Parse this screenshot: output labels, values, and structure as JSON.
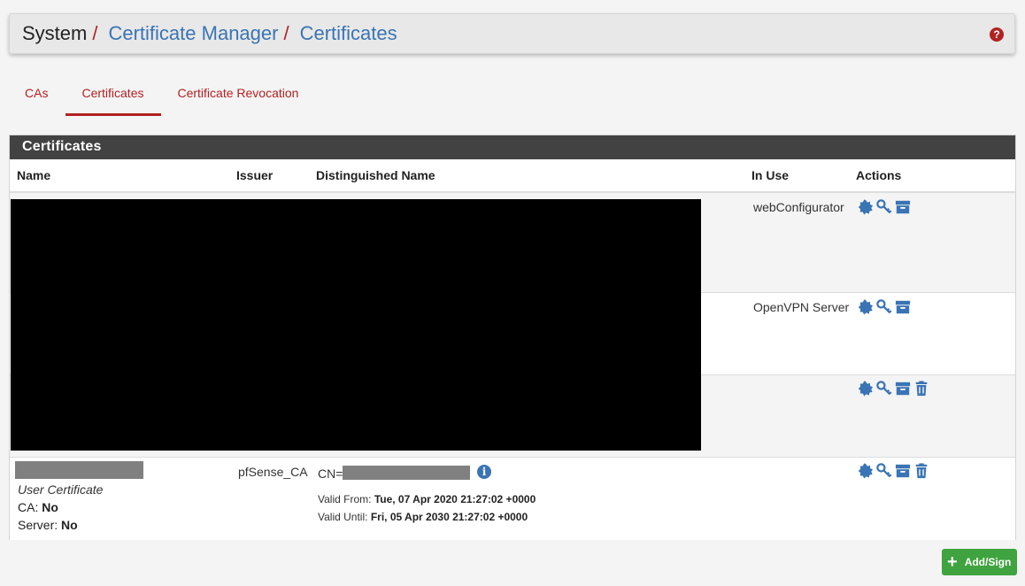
{
  "breadcrumb": {
    "root": "System",
    "sep": "/",
    "level1": "Certificate Manager",
    "level2": "Certificates",
    "help_glyph": "?"
  },
  "tabs": [
    {
      "label": "CAs",
      "active": false
    },
    {
      "label": "Certificates",
      "active": true
    },
    {
      "label": "Certificate Revocation",
      "active": false
    }
  ],
  "panel": {
    "title": "Certificates",
    "columns": [
      "Name",
      "Issuer",
      "Distinguished Name",
      "In Use",
      "Actions"
    ]
  },
  "rows": [
    {
      "in_use": "webConfigurator",
      "actions": [
        "export-certificate-icon",
        "export-key-icon",
        "export-p12-icon"
      ]
    },
    {
      "in_use": "OpenVPN Server",
      "actions": [
        "export-certificate-icon",
        "export-key-icon",
        "export-p12-icon"
      ]
    },
    {
      "in_use": "",
      "actions": [
        "export-certificate-icon",
        "export-key-icon",
        "export-p12-icon",
        "delete-icon"
      ]
    },
    {
      "type": "User Certificate",
      "ca_label": "CA:",
      "ca_value": "No",
      "server_label": "Server:",
      "server_value": "No",
      "issuer": "pfSense_CA",
      "dn_prefix": "CN=",
      "valid_from_label": "Valid From:",
      "valid_from": "Tue, 07 Apr 2020 21:27:02 +0000",
      "valid_until_label": "Valid Until:",
      "valid_until": "Fri, 05 Apr 2030 21:27:02 +0000",
      "info_glyph": "i",
      "in_use": "",
      "actions": [
        "export-certificate-icon",
        "export-key-icon",
        "export-p12-icon",
        "delete-icon"
      ]
    }
  ],
  "add_button": {
    "label": "Add/Sign",
    "icon": "plus-icon",
    "glyph": "+"
  },
  "colors": {
    "accent": "#b22222",
    "link": "#3a74b4",
    "panel_header": "#424242",
    "success": "#3fa33f",
    "icon": "#3a74b4"
  }
}
